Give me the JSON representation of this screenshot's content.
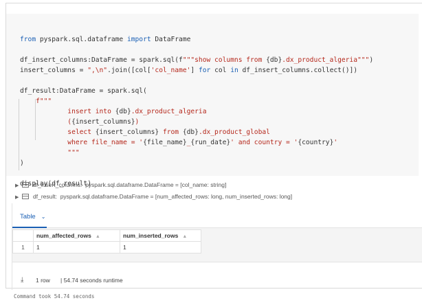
{
  "code_lines": [
    {
      "segments": [
        {
          "t": "from",
          "c": "kw"
        },
        {
          "t": " pyspark.sql.dataframe ",
          "c": ""
        },
        {
          "t": "import",
          "c": "kw"
        },
        {
          "t": " DataFrame",
          "c": ""
        }
      ]
    },
    {
      "segments": []
    },
    {
      "segments": [
        {
          "t": "df_insert_columns:DataFrame = spark.sql(f",
          "c": ""
        },
        {
          "t": "\"\"\"show columns from ",
          "c": "str"
        },
        {
          "t": "{db}",
          "c": ""
        },
        {
          "t": ".dx_product_algeria\"\"\"",
          "c": "str"
        },
        {
          "t": ")",
          "c": ""
        }
      ]
    },
    {
      "segments": [
        {
          "t": "insert_columns = ",
          "c": ""
        },
        {
          "t": "\",\\n\"",
          "c": "str"
        },
        {
          "t": ".join([col[",
          "c": ""
        },
        {
          "t": "'col_name'",
          "c": "str"
        },
        {
          "t": "] ",
          "c": ""
        },
        {
          "t": "for",
          "c": "kw"
        },
        {
          "t": " col ",
          "c": ""
        },
        {
          "t": "in",
          "c": "kw"
        },
        {
          "t": " df_insert_columns.collect()])",
          "c": ""
        }
      ]
    },
    {
      "segments": []
    },
    {
      "segments": [
        {
          "t": "df_result:DataFrame = spark.sql(",
          "c": ""
        }
      ]
    },
    {
      "segments": [
        {
          "t": "    f\"\"\"",
          "c": "str"
        }
      ]
    },
    {
      "segments": [
        {
          "t": "            insert into ",
          "c": "str"
        },
        {
          "t": "{db}",
          "c": ""
        },
        {
          "t": ".dx_product_algeria",
          "c": "str"
        }
      ]
    },
    {
      "segments": [
        {
          "t": "            (",
          "c": "str"
        },
        {
          "t": "{insert_columns}",
          "c": ""
        },
        {
          "t": ")",
          "c": "str"
        }
      ]
    },
    {
      "segments": [
        {
          "t": "            select ",
          "c": "str"
        },
        {
          "t": "{insert_columns}",
          "c": ""
        },
        {
          "t": " from ",
          "c": "str"
        },
        {
          "t": "{db}",
          "c": ""
        },
        {
          "t": ".dx_product_global",
          "c": "str"
        }
      ]
    },
    {
      "segments": [
        {
          "t": "            where file_name = '",
          "c": "str"
        },
        {
          "t": "{file_name}",
          "c": ""
        },
        {
          "t": "_",
          "c": "str"
        },
        {
          "t": "{run_date}",
          "c": ""
        },
        {
          "t": "' and country = '",
          "c": "str"
        },
        {
          "t": "{country}",
          "c": ""
        },
        {
          "t": "'",
          "c": "str"
        }
      ]
    },
    {
      "segments": [
        {
          "t": "            \"\"\"",
          "c": "str"
        }
      ]
    },
    {
      "segments": [
        {
          "t": ")",
          "c": ""
        }
      ]
    },
    {
      "segments": []
    },
    {
      "segments": [
        {
          "t": "display(df_result)",
          "c": ""
        }
      ]
    }
  ],
  "results": [
    {
      "name": "df_insert_columns:",
      "schema": "pyspark.sql.dataframe.DataFrame = [col_name: string]"
    },
    {
      "name": "df_result:",
      "schema": "pyspark.sql.dataframe.DataFrame = [num_affected_rows: long, num_inserted_rows: long]"
    }
  ],
  "tab": {
    "label": "Table"
  },
  "table": {
    "columns": [
      "num_affected_rows",
      "num_inserted_rows"
    ],
    "rows": [
      {
        "index": "1",
        "cells": [
          "1",
          "1"
        ]
      }
    ]
  },
  "footer": {
    "rows": "1 row",
    "runtime": "| 54.74 seconds runtime"
  },
  "command_text": "Command took 54.74 seconds",
  "colors": {
    "keyword": "#1a5fb4",
    "string": "#b5281c",
    "accent": "#1a5fb4"
  }
}
